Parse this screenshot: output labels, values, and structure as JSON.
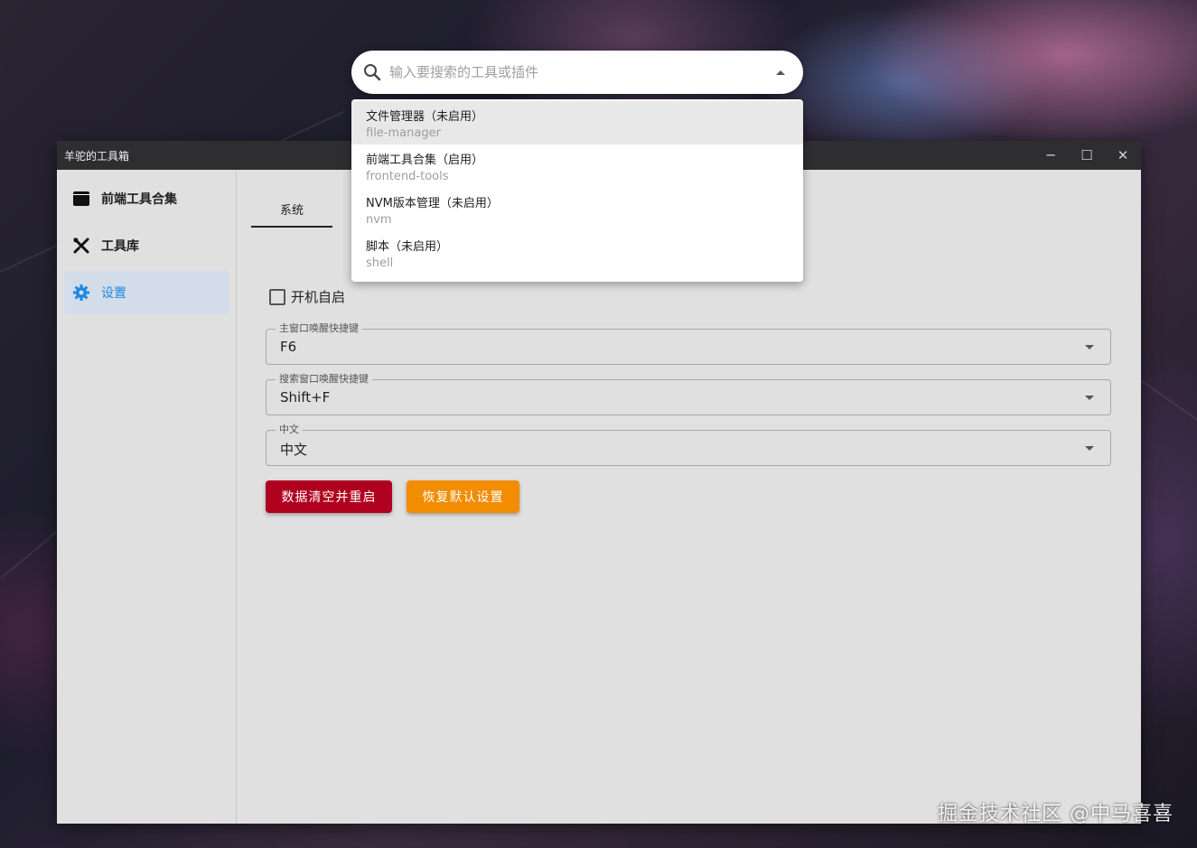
{
  "window": {
    "title": "羊驼的工具箱",
    "minimize_glyph": "─",
    "maximize_glyph": "☐",
    "close_glyph": "✕"
  },
  "sidebar": {
    "items": [
      {
        "label": "前端工具合集",
        "icon": "window-icon",
        "active": false
      },
      {
        "label": "工具库",
        "icon": "tools-icon",
        "active": false
      },
      {
        "label": "设置",
        "icon": "gear-icon",
        "active": true
      }
    ]
  },
  "tabs": [
    {
      "label": "系统",
      "active": true
    }
  ],
  "settings": {
    "autostart_label": "开机自启",
    "autostart_checked": false,
    "main_hotkey": {
      "label": "主窗口唤醒快捷键",
      "value": "F6"
    },
    "search_hotkey": {
      "label": "搜索窗口唤醒快捷键",
      "value": "Shift+F"
    },
    "language": {
      "label": "中文",
      "value": "中文"
    },
    "reset_button": "数据清空并重启",
    "restore_button": "恢复默认设置"
  },
  "colors": {
    "accent": "#1e88e5",
    "danger": "#b00020",
    "warning": "#f28c00",
    "active_nav_bg": "#d2dde9"
  },
  "search": {
    "placeholder": "输入要搜索的工具或插件",
    "value": ""
  },
  "dropdown": {
    "items": [
      {
        "title": "文件管理器（未启用）",
        "id": "file-manager",
        "hover": true
      },
      {
        "title": "前端工具合集（启用）",
        "id": "frontend-tools",
        "hover": false
      },
      {
        "title": "NVM版本管理（未启用）",
        "id": "nvm",
        "hover": false
      },
      {
        "title": "脚本（未启用）",
        "id": "shell",
        "hover": false
      }
    ]
  },
  "watermark": "掘金技术社区 @中马喜喜"
}
